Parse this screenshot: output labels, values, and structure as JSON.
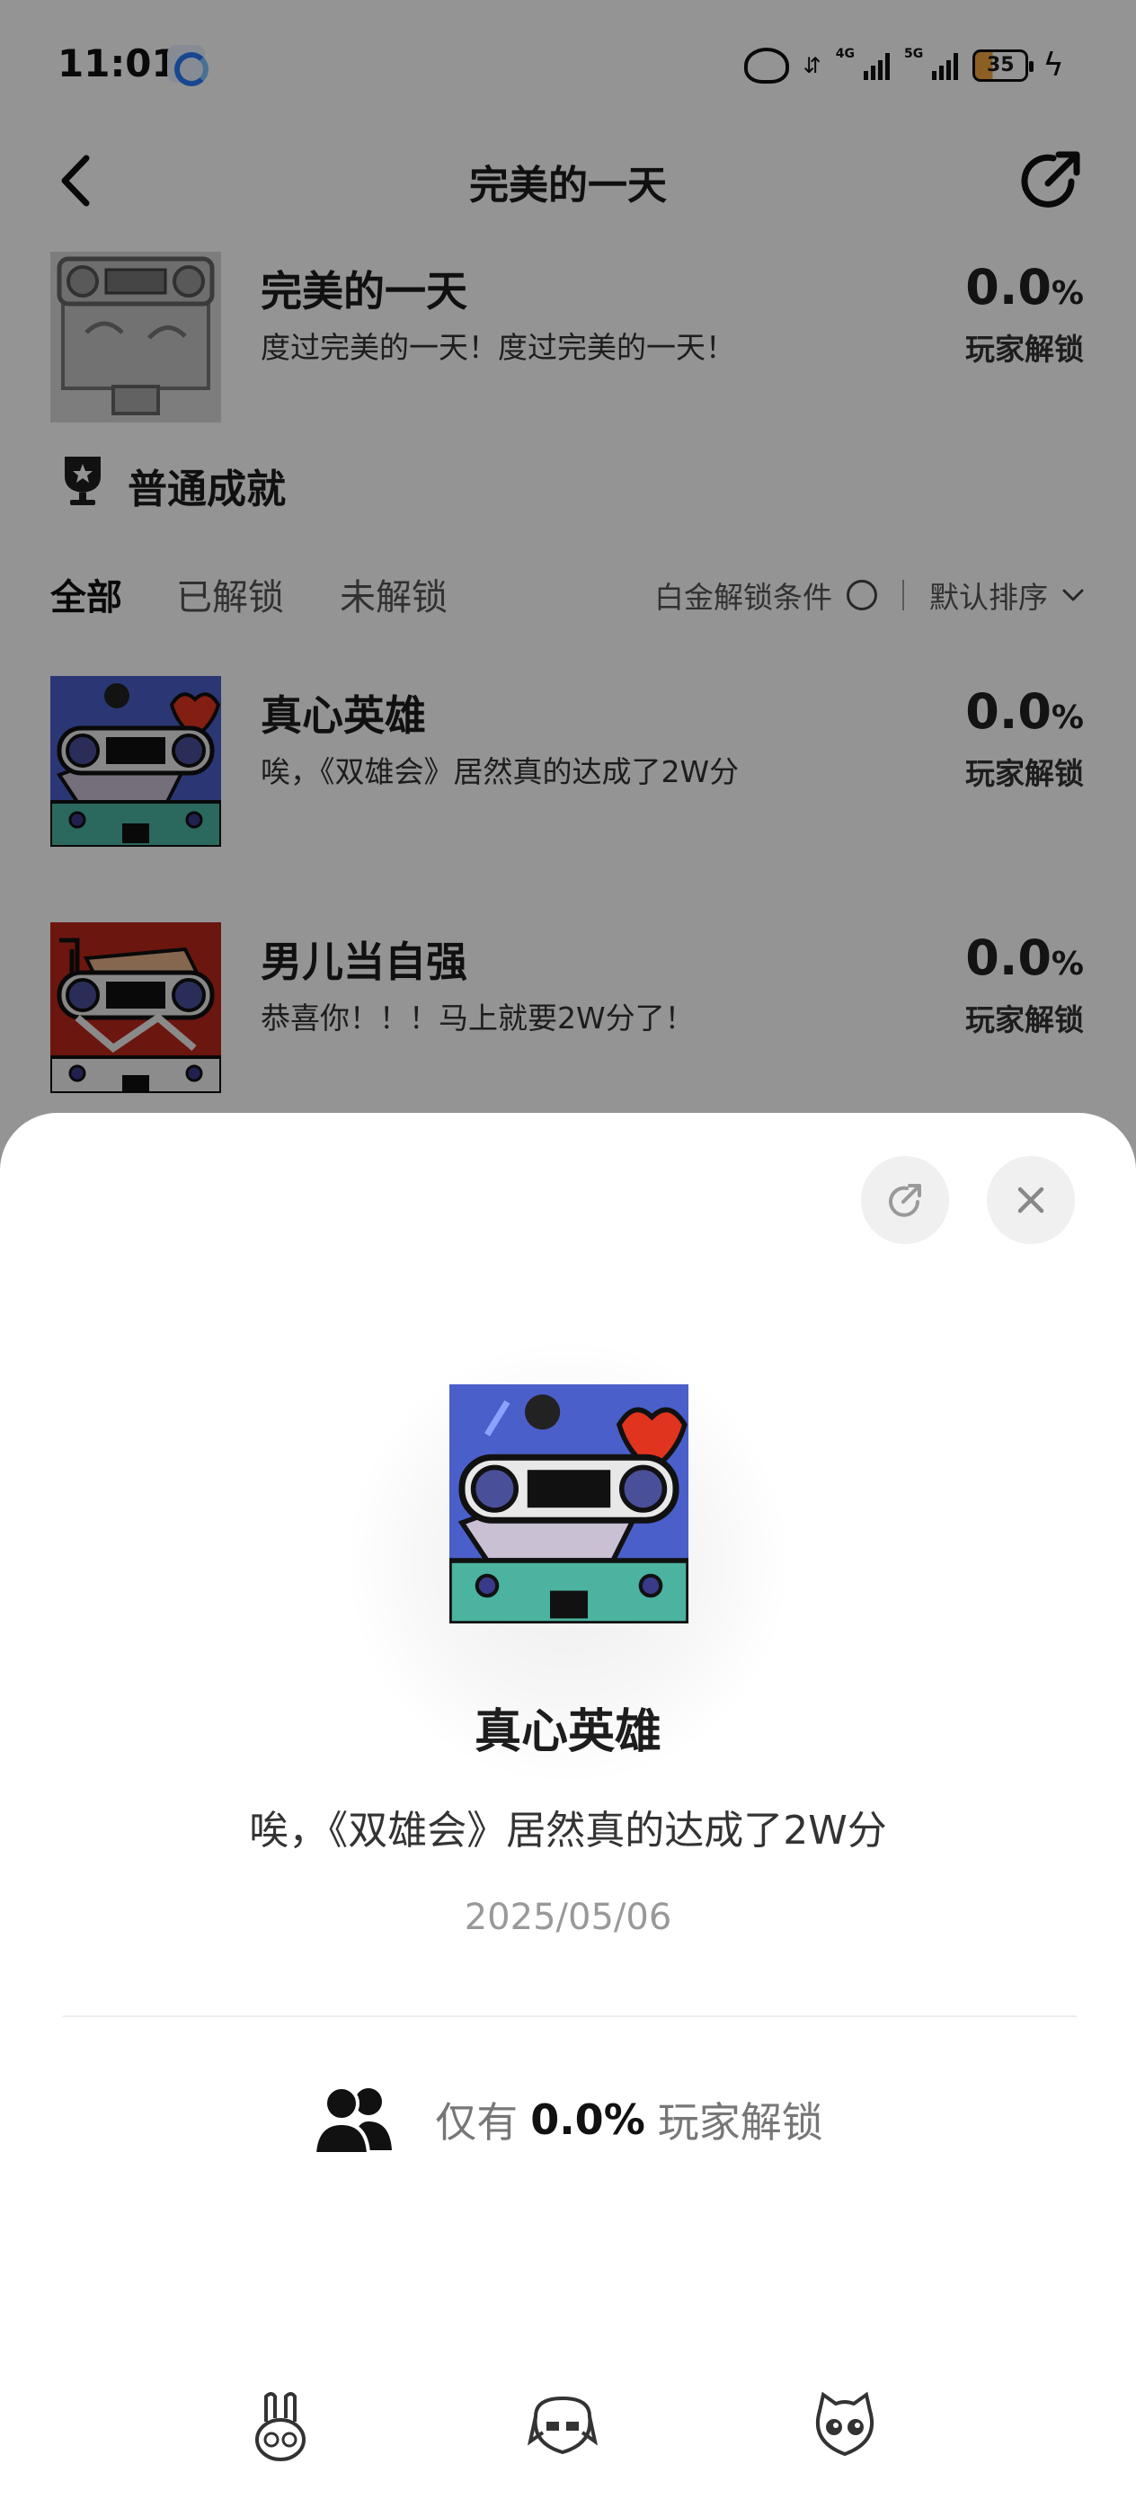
{
  "status_bar": {
    "time": "11:01",
    "net1": "4G",
    "net2": "5G",
    "battery": "35"
  },
  "nav": {
    "title": "完美的一天"
  },
  "top_achievement": {
    "title": "完美的一天",
    "description": "度过完美的一天！度过完美的一天！",
    "percent": "0.0",
    "percent_unit": "%",
    "percent_label": "玩家解锁"
  },
  "section": {
    "title": "普通成就"
  },
  "filters": {
    "tabs": [
      "全部",
      "已解锁",
      "未解锁"
    ],
    "platinum_label": "白金解锁条件",
    "sort_label": "默认排序"
  },
  "achievements": [
    {
      "title": "真心英雄",
      "description": "唉，《双雄会》居然真的达成了2W分",
      "percent": "0.0",
      "percent_unit": "%",
      "percent_label": "玩家解锁"
    },
    {
      "title": "男儿当自强",
      "description": "恭喜你！！！马上就要2W分了！",
      "percent": "0.0",
      "percent_unit": "%",
      "percent_label": "玩家解锁"
    }
  ],
  "sheet": {
    "title": "真心英雄",
    "description": "唉，《双雄会》居然真的达成了2W分",
    "date": "2025/05/06",
    "unlock_prefix": "仅有",
    "unlock_value": "0.0%",
    "unlock_suffix": "玩家解锁"
  },
  "icons": {
    "back": "chevron-left-icon",
    "share": "share-icon",
    "close": "close-icon",
    "people": "people-icon",
    "trophy": "trophy-icon"
  }
}
